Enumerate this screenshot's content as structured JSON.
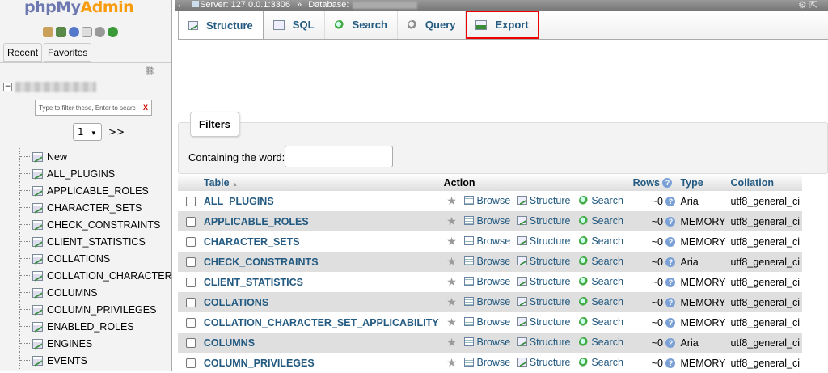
{
  "nav": {
    "logo_part1": "php",
    "logo_part2": "My",
    "logo_part3": "Admin",
    "tab_recent": "Recent",
    "tab_favorites": "Favorites",
    "filter_placeholder": "Type to filter these, Enter to searc",
    "filter_clear": "X",
    "page_value": "1",
    "page_next": ">>",
    "tree": [
      "New",
      "ALL_PLUGINS",
      "APPLICABLE_ROLES",
      "CHARACTER_SETS",
      "CHECK_CONSTRAINTS",
      "CLIENT_STATISTICS",
      "COLLATIONS",
      "COLLATION_CHARACTER_S",
      "COLUMNS",
      "COLUMN_PRIVILEGES",
      "ENABLED_ROLES",
      "ENGINES",
      "EVENTS"
    ]
  },
  "topbar": {
    "server": "Server: 127.0.0.1:3306",
    "separator": "»",
    "database_label": "Database:"
  },
  "tabs": {
    "structure": "Structure",
    "sql": "SQL",
    "search": "Search",
    "query": "Query",
    "export": "Export"
  },
  "filters": {
    "legend": "Filters",
    "label": "Containing the word:"
  },
  "table": {
    "headers": {
      "table": "Table",
      "sort": "▲",
      "action": "Action",
      "rows": "Rows",
      "type": "Type",
      "collation": "Collation"
    },
    "actions": {
      "browse": "Browse",
      "structure": "Structure",
      "search": "Search"
    },
    "rows": [
      {
        "name": "ALL_PLUGINS",
        "rows": "~0",
        "type": "Aria",
        "collation": "utf8_general_ci"
      },
      {
        "name": "APPLICABLE_ROLES",
        "rows": "~0",
        "type": "MEMORY",
        "collation": "utf8_general_ci"
      },
      {
        "name": "CHARACTER_SETS",
        "rows": "~0",
        "type": "MEMORY",
        "collation": "utf8_general_ci"
      },
      {
        "name": "CHECK_CONSTRAINTS",
        "rows": "~0",
        "type": "Aria",
        "collation": "utf8_general_ci"
      },
      {
        "name": "CLIENT_STATISTICS",
        "rows": "~0",
        "type": "MEMORY",
        "collation": "utf8_general_ci"
      },
      {
        "name": "COLLATIONS",
        "rows": "~0",
        "type": "MEMORY",
        "collation": "utf8_general_ci"
      },
      {
        "name": "COLLATION_CHARACTER_SET_APPLICABILITY",
        "rows": "~0",
        "type": "MEMORY",
        "collation": "utf8_general_ci"
      },
      {
        "name": "COLUMNS",
        "rows": "~0",
        "type": "Aria",
        "collation": "utf8_general_ci"
      },
      {
        "name": "COLUMN_PRIVILEGES",
        "rows": "~0",
        "type": "MEMORY",
        "collation": "utf8_general_ci"
      }
    ]
  },
  "colors": {
    "link": "#235a81",
    "highlight": "#e00000",
    "logo_blue": "#6c78af",
    "logo_orange": "#f89c0e"
  }
}
